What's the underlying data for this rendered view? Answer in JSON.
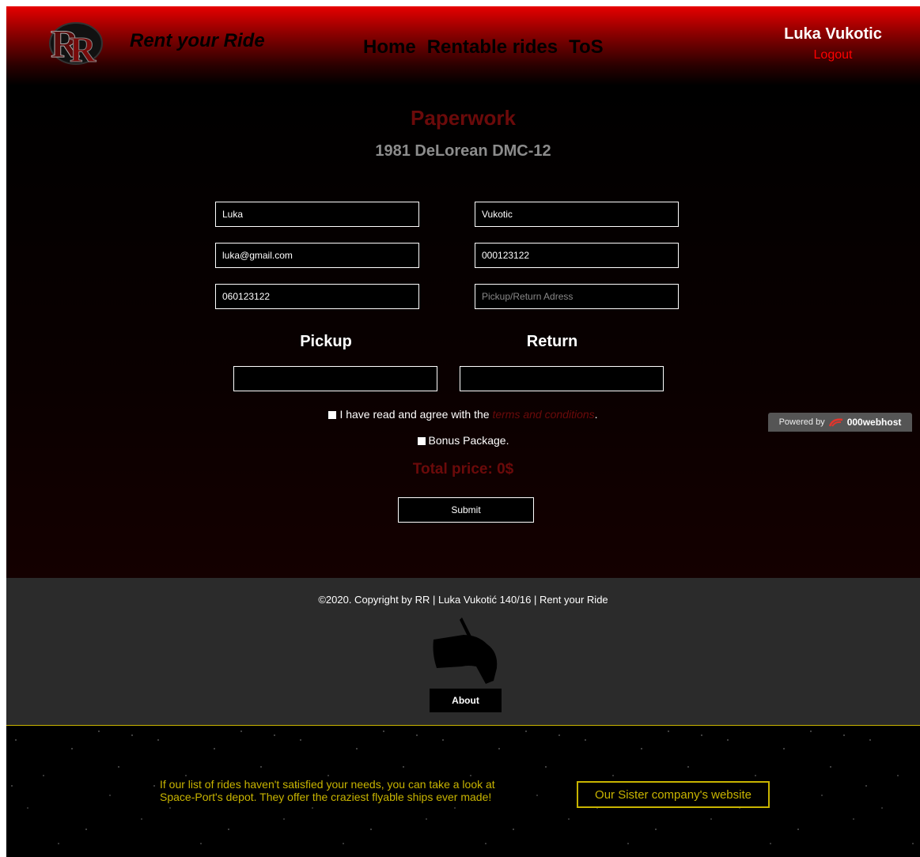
{
  "header": {
    "logo_text": "RR",
    "brand": "Rent your Ride",
    "nav": [
      "Home",
      "Rentable rides",
      "ToS"
    ],
    "user_name": "Luka Vukotic",
    "logout": "Logout"
  },
  "main": {
    "title": "Paperwork",
    "car": "1981 DeLorean DMC-12",
    "form": {
      "first_name": "Luka",
      "last_name": "Vukotic",
      "email": "luka@gmail.com",
      "id_number": "000123122",
      "phone": "060123122",
      "address_placeholder": "Pickup/Return Adress"
    },
    "pickup_label": "Pickup",
    "return_label": "Return",
    "terms_text": "I have read and agree with the",
    "terms_link": "terms and conditions",
    "terms_end": ".",
    "bonus_text": "Bonus Package.",
    "total": "Total price: 0$",
    "submit": "Submit"
  },
  "badge": {
    "powered_by": "Powered by",
    "host": "000webhost"
  },
  "footer": {
    "copyright": "©2020. Copyright by RR | Luka Vukotić 140/16 | Rent your Ride",
    "about": "About"
  },
  "sister": {
    "text": "If our list of rides haven't satisfied your needs, you can take a look at Space-Port's depot. They offer the craziest flyable ships ever made!",
    "link": "Our Sister company's website"
  },
  "colors": {
    "accent_red": "#ff0000",
    "dark_red": "#6b0a0a",
    "gold": "#c8b400"
  }
}
